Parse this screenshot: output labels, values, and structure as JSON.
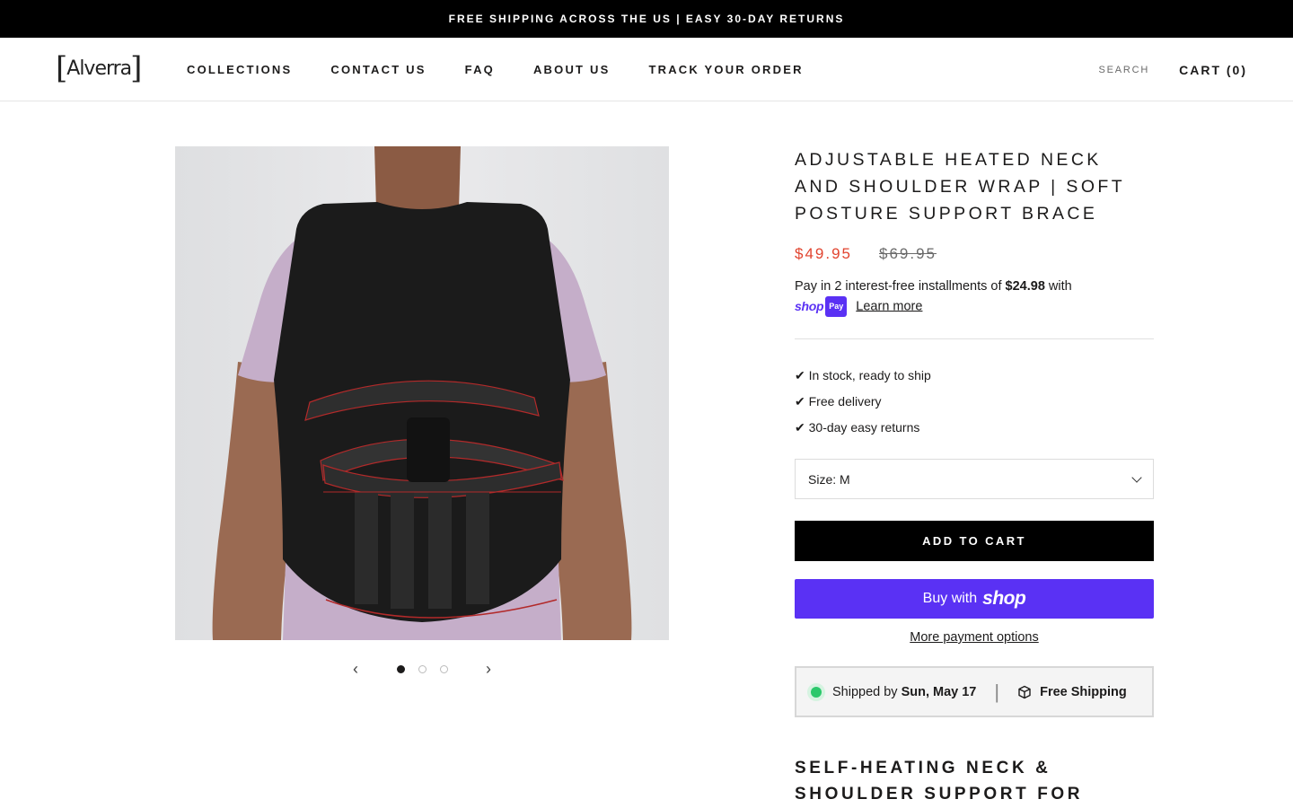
{
  "announcement": "FREE SHIPPING ACROSS THE US | EASY 30-DAY RETURNS",
  "logo": {
    "left": "[",
    "text": "Alverra",
    "right": "]"
  },
  "nav": [
    "COLLECTIONS",
    "CONTACT US",
    "FAQ",
    "ABOUT US",
    "TRACK YOUR ORDER"
  ],
  "header_right": {
    "search": "SEARCH",
    "cart": "CART (0)"
  },
  "gallery": {
    "image_count": 3,
    "active_index": 1,
    "prev_icon": "chevron-left-icon",
    "next_icon": "chevron-right-icon"
  },
  "product": {
    "title": "ADJUSTABLE HEATED NECK AND SHOULDER WRAP | SOFT POSTURE SUPPORT BRACE",
    "price": "$49.95",
    "compare_price": "$69.95",
    "installment": {
      "prefix": "Pay in 2 interest-free installments of",
      "amount": "$24.98",
      "suffix": "with",
      "shop": "shop",
      "pay": "Pay",
      "learn_more": "Learn more"
    },
    "bullets": [
      "✔ In stock, ready to ship",
      "✔ Free delivery",
      "✔ 30-day easy returns"
    ],
    "size_label": "Size: M",
    "add_to_cart": "ADD TO CART",
    "buy_with": "Buy with",
    "buy_brand": "shop",
    "more_payment": "More payment options",
    "shipping": {
      "prefix": "Shipped by",
      "date": "Sun, May 17",
      "divider": "|",
      "free": "Free Shipping"
    },
    "section_title": "SELF-HEATING NECK & SHOULDER SUPPORT FOR"
  },
  "colors": {
    "accent_red": "#e1432e",
    "shop_purple": "#5a31f4",
    "status_green": "#2bc86b"
  }
}
